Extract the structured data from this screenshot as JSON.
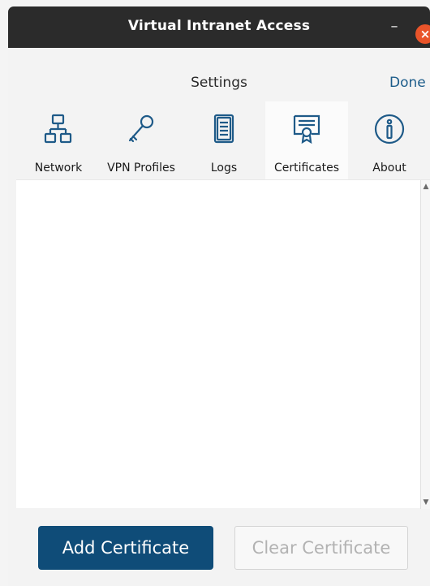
{
  "window": {
    "title": "Virtual Intranet Access",
    "minimize_glyph": "–",
    "close_glyph": "×"
  },
  "header": {
    "title": "Settings",
    "done_label": "Done"
  },
  "tabs": [
    {
      "label": "Network",
      "icon": "network-icon"
    },
    {
      "label": "VPN Profiles",
      "icon": "key-icon"
    },
    {
      "label": "Logs",
      "icon": "document-icon"
    },
    {
      "label": "Certificates",
      "icon": "certificate-icon",
      "active": true
    },
    {
      "label": "About",
      "icon": "info-icon"
    }
  ],
  "scrollbar": {
    "up": "▲",
    "down": "▼"
  },
  "buttons": {
    "add_label": "Add Certificate",
    "clear_label": "Clear Certificate"
  },
  "colors": {
    "accent": "#0f4c78",
    "link": "#1c5c8a",
    "icon": "#1e5a88",
    "close": "#e9542a"
  }
}
